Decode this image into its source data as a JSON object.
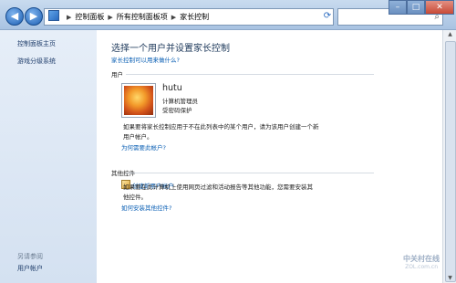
{
  "titlebar": {
    "back_icon": "back-arrow-icon",
    "forward_icon": "forward-arrow-icon",
    "breadcrumb": [
      "控制面板",
      "所有控制面板项",
      "家长控制"
    ],
    "search_icon": "search-icon",
    "refresh_icon": "refresh-icon"
  },
  "sidebar": {
    "items": [
      "控制面板主页",
      "游戏分级系统"
    ],
    "see_also_title": "另请参阅",
    "see_also_items": [
      "用户帐户"
    ]
  },
  "main": {
    "heading": "选择一个用户并设置家长控制",
    "help_link": "家长控制可以用来做什么?",
    "users_section": "用户",
    "user": {
      "name": "hutu",
      "role": "计算机管理员",
      "password_status": "受密码保护"
    },
    "note": "如果要将家长控制应用于不在此列表中的某个用户，请为该用户创建一个新用户帐户。",
    "why_link": "为何需要此帐户?",
    "create_link": "创建新用户帐户",
    "other_section": "其他控件",
    "other_note": "如果要在此计算机上使用网页过滤和活动报告等其他功能，您需要安装其他控件。",
    "install_link": "如何安装其他控件?"
  },
  "watermark": {
    "cn": "中关村在线",
    "en": "ZOL.com.cn"
  },
  "colors": {
    "link": "#0a5fb4",
    "heading": "#1e395b",
    "sidebar_text": "#1f3d6b"
  }
}
